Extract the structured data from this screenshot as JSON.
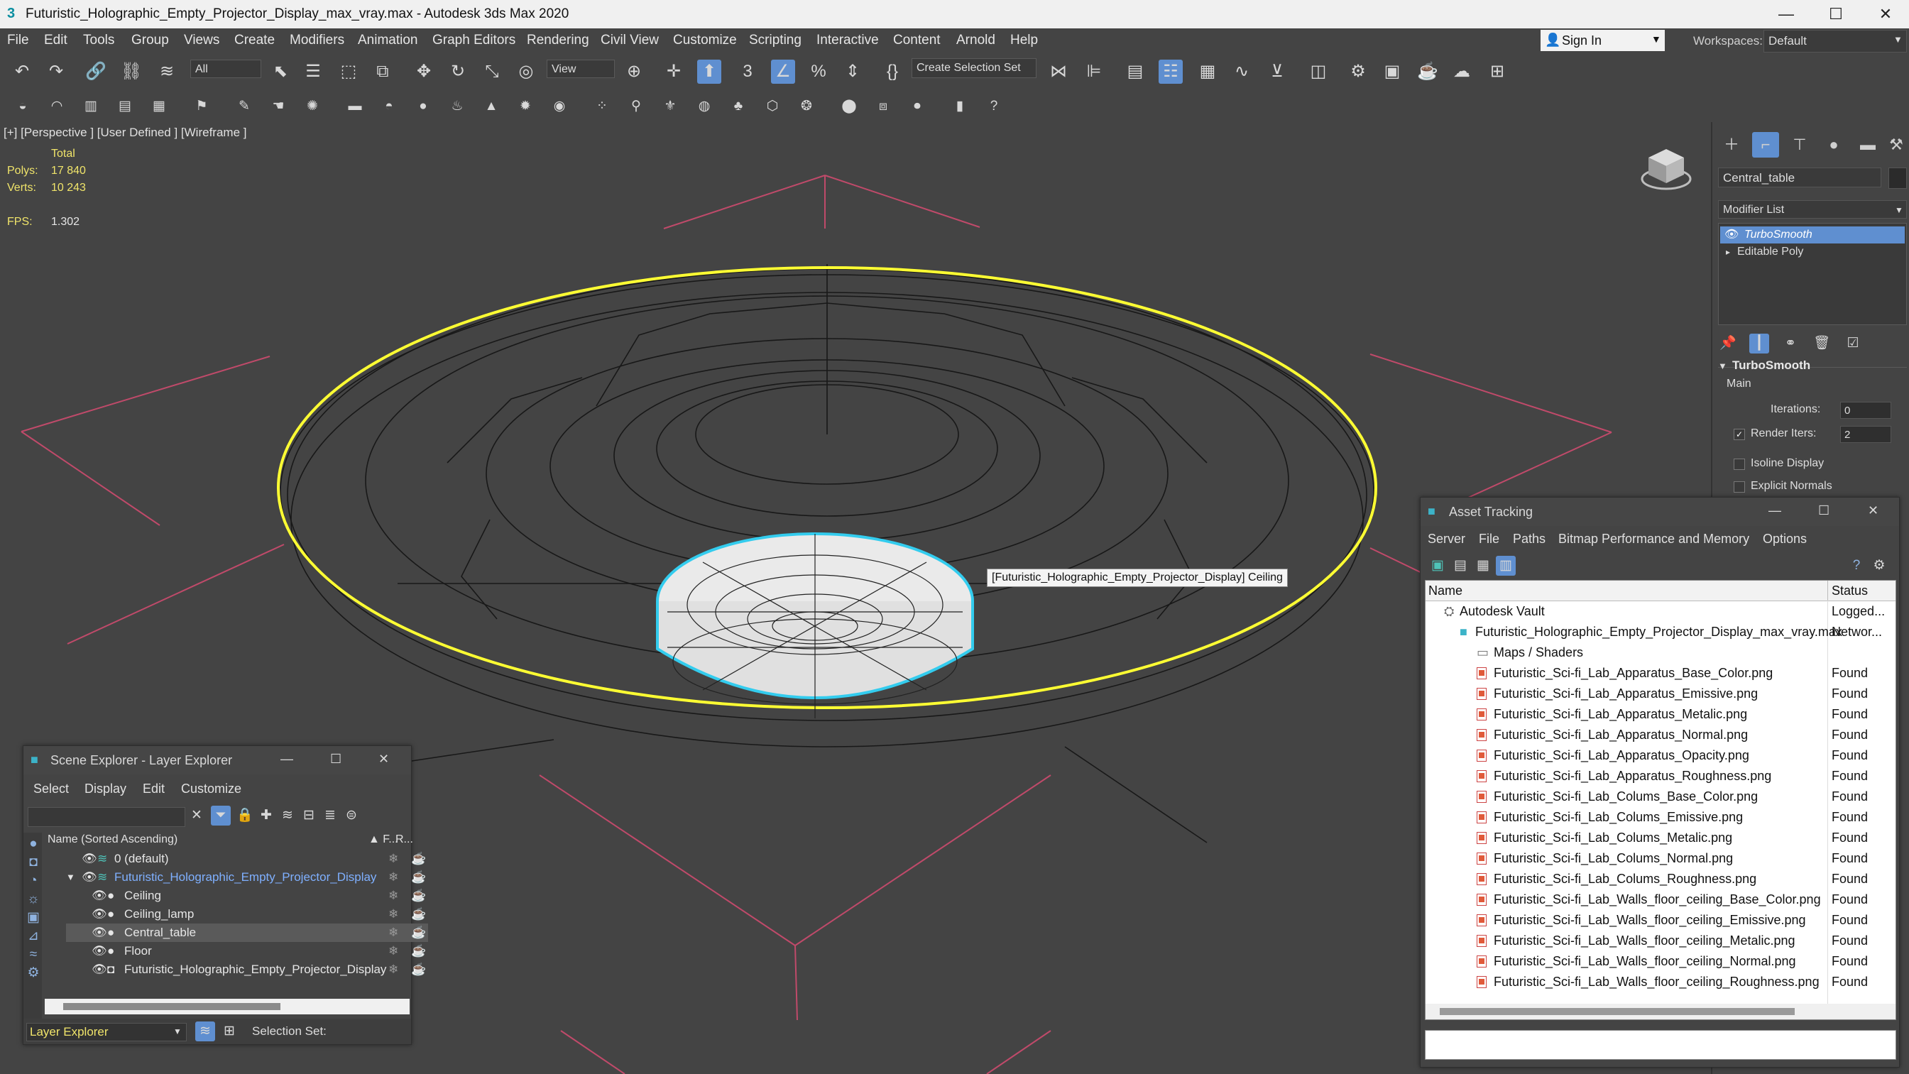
{
  "window": {
    "title": "Futuristic_Holographic_Empty_Projector_Display_max_vray.max - Autodesk 3ds Max 2020",
    "minimize": "—",
    "maximize": "☐",
    "close": "✕"
  },
  "menu": [
    "File",
    "Edit",
    "Tools",
    "Group",
    "Views",
    "Create",
    "Modifiers",
    "Animation",
    "Graph Editors",
    "Rendering",
    "Civil View",
    "Customize",
    "Scripting",
    "Interactive",
    "Content",
    "Arnold",
    "Help"
  ],
  "signin": "Sign In",
  "workspaces": {
    "label": "Workspaces:",
    "value": "Default"
  },
  "toolbar": {
    "selection_filter": "All",
    "reference_coord": "View",
    "create_selection_set": "Create Selection Set"
  },
  "viewport": {
    "label": "[+] [Perspective ] [User Defined ] [Wireframe ]",
    "stats_header": "Total",
    "polys_label": "Polys:",
    "polys_value": "17 840",
    "verts_label": "Verts:",
    "verts_value": "10 243",
    "fps_label": "FPS:",
    "fps_value": "1.302",
    "tooltip": "[Futuristic_Holographic_Empty_Projector_Display] Ceiling",
    "colors": {
      "background": "#444444",
      "wire": "#141414",
      "selected": "#ffff33",
      "highlight": "#33ccee",
      "grid": "#c04a6a"
    }
  },
  "command_panel": {
    "object_name": "Central_table",
    "modifier_list": "Modifier List",
    "stack": [
      "TurboSmooth",
      "Editable Poly"
    ],
    "rollout": "TurboSmooth",
    "group": "Main",
    "iterations_label": "Iterations:",
    "iterations_value": "0",
    "render_iters_label": "Render Iters:",
    "render_iters_value": "2",
    "isoline_label": "Isoline Display",
    "explicit_normals_label": "Explicit Normals",
    "check": "✓"
  },
  "scene_explorer": {
    "title": "Scene Explorer - Layer Explorer",
    "menu": [
      "Select",
      "Display",
      "Edit",
      "Customize"
    ],
    "col_name": "Name (Sorted Ascending)",
    "col_f": "▲ F...",
    "col_r": "R...",
    "rows": [
      {
        "name": "0 (default)"
      },
      {
        "name": "Futuristic_Holographic_Empty_Projector_Display"
      },
      {
        "name": "Ceiling"
      },
      {
        "name": "Ceiling_lamp"
      },
      {
        "name": "Central_table"
      },
      {
        "name": "Floor"
      },
      {
        "name": "Futuristic_Holographic_Empty_Projector_Display"
      }
    ],
    "footer_dropdown": "Layer Explorer",
    "selection_set": "Selection Set:"
  },
  "asset_tracking": {
    "title": "Asset Tracking",
    "menu": [
      "Server",
      "File",
      "Paths",
      "Bitmap Performance and Memory",
      "Options"
    ],
    "col_name": "Name",
    "col_status": "Status",
    "vault": {
      "name": "Autodesk Vault",
      "status": "Logged..."
    },
    "scene_file": {
      "name": "Futuristic_Holographic_Empty_Projector_Display_max_vray.max",
      "status": "Networ..."
    },
    "maps_folder": "Maps / Shaders",
    "files": [
      {
        "name": "Futuristic_Sci-fi_Lab_Apparatus_Base_Color.png",
        "status": "Found"
      },
      {
        "name": "Futuristic_Sci-fi_Lab_Apparatus_Emissive.png",
        "status": "Found"
      },
      {
        "name": "Futuristic_Sci-fi_Lab_Apparatus_Metalic.png",
        "status": "Found"
      },
      {
        "name": "Futuristic_Sci-fi_Lab_Apparatus_Normal.png",
        "status": "Found"
      },
      {
        "name": "Futuristic_Sci-fi_Lab_Apparatus_Opacity.png",
        "status": "Found"
      },
      {
        "name": "Futuristic_Sci-fi_Lab_Apparatus_Roughness.png",
        "status": "Found"
      },
      {
        "name": "Futuristic_Sci-fi_Lab_Colums_Base_Color.png",
        "status": "Found"
      },
      {
        "name": "Futuristic_Sci-fi_Lab_Colums_Emissive.png",
        "status": "Found"
      },
      {
        "name": "Futuristic_Sci-fi_Lab_Colums_Metalic.png",
        "status": "Found"
      },
      {
        "name": "Futuristic_Sci-fi_Lab_Colums_Normal.png",
        "status": "Found"
      },
      {
        "name": "Futuristic_Sci-fi_Lab_Colums_Roughness.png",
        "status": "Found"
      },
      {
        "name": "Futuristic_Sci-fi_Lab_Walls_floor_ceiling_Base_Color.png",
        "status": "Found"
      },
      {
        "name": "Futuristic_Sci-fi_Lab_Walls_floor_ceiling_Emissive.png",
        "status": "Found"
      },
      {
        "name": "Futuristic_Sci-fi_Lab_Walls_floor_ceiling_Metalic.png",
        "status": "Found"
      },
      {
        "name": "Futuristic_Sci-fi_Lab_Walls_floor_ceiling_Normal.png",
        "status": "Found"
      },
      {
        "name": "Futuristic_Sci-fi_Lab_Walls_floor_ceiling_Roughness.png",
        "status": "Found"
      }
    ]
  }
}
